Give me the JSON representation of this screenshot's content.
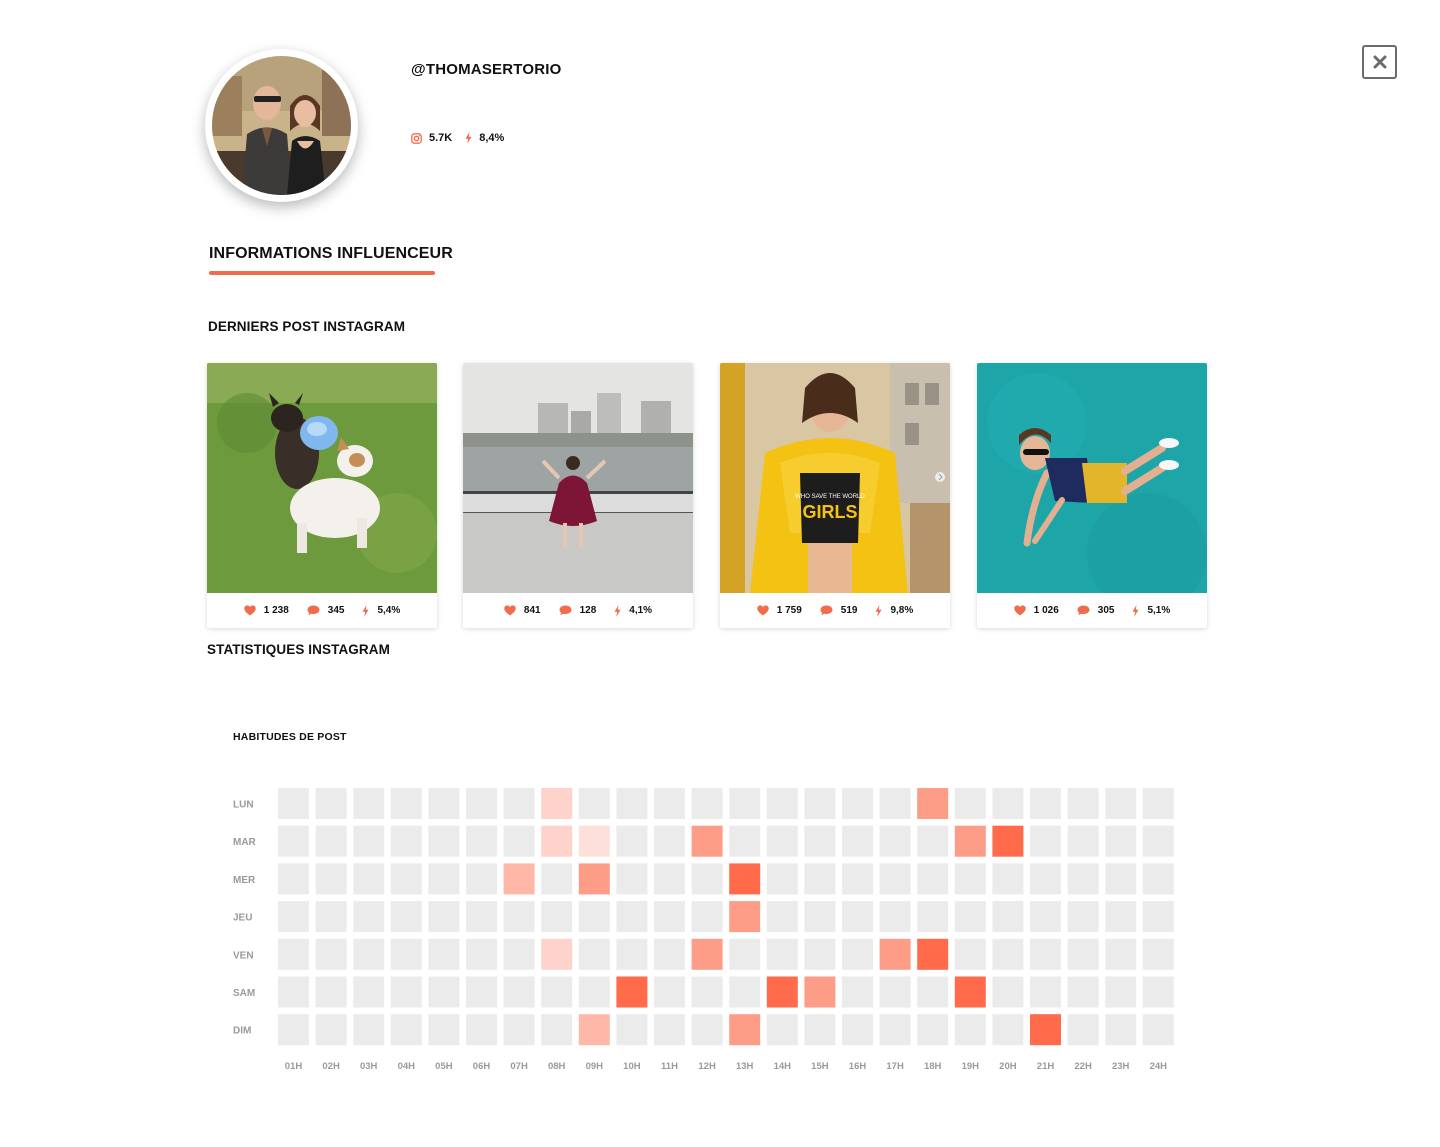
{
  "profile": {
    "handle": "@THOMASERTORIO",
    "followers": "5.7K",
    "engagement": "8,4%"
  },
  "tabs": {
    "active": "INFORMATIONS INFLUENCEUR"
  },
  "sections": {
    "posts_title": "DERNIERS POST INSTAGRAM",
    "stats_title": "STATISTIQUES INSTAGRAM"
  },
  "posts": [
    {
      "likes": "1 238",
      "comments": "345",
      "engagement": "5,4%"
    },
    {
      "likes": "841",
      "comments": "128",
      "engagement": "4,1%"
    },
    {
      "likes": "1 759",
      "comments": "519",
      "engagement": "9,8%"
    },
    {
      "likes": "1 026",
      "comments": "305",
      "engagement": "5,1%"
    }
  ],
  "colors": {
    "accent": "#f16b4d",
    "empty_cell": "#ebebeb"
  },
  "icons": {
    "close": "close-icon",
    "instagram": "instagram-icon",
    "bolt": "bolt-icon",
    "heart": "heart-icon",
    "comment": "comment-icon"
  },
  "chart_data": {
    "type": "heatmap",
    "title": "HABITUDES DE POST",
    "rows": [
      "LUN",
      "MAR",
      "MER",
      "JEU",
      "VEN",
      "SAM",
      "DIM"
    ],
    "columns": [
      "01H",
      "02H",
      "03H",
      "04H",
      "05H",
      "06H",
      "07H",
      "08H",
      "09H",
      "10H",
      "11H",
      "12H",
      "13H",
      "14H",
      "15H",
      "16H",
      "17H",
      "18H",
      "19H",
      "20H",
      "21H",
      "22H",
      "23H",
      "24H"
    ],
    "values": [
      [
        0,
        0,
        0,
        0,
        0,
        0,
        0,
        1,
        0,
        0,
        0,
        0,
        0,
        0,
        0,
        0,
        0,
        3,
        0,
        0,
        0,
        0,
        0,
        0
      ],
      [
        0,
        0,
        0,
        0,
        0,
        0,
        0,
        1,
        0.5,
        0,
        0,
        3,
        0,
        0,
        0,
        0,
        0,
        0,
        3,
        4,
        0,
        0,
        0,
        0
      ],
      [
        0,
        0,
        0,
        0,
        0,
        0,
        2,
        0,
        3,
        0,
        0,
        0,
        4,
        0,
        0,
        0,
        0,
        0,
        0,
        0,
        0,
        0,
        0,
        0
      ],
      [
        0,
        0,
        0,
        0,
        0,
        0,
        0,
        0,
        0,
        0,
        0,
        0,
        3,
        0,
        0,
        0,
        0,
        0,
        0,
        0,
        0,
        0,
        0,
        0
      ],
      [
        0,
        0,
        0,
        0,
        0,
        0,
        0,
        1,
        0,
        0,
        0,
        3,
        0,
        0,
        0,
        0,
        3,
        4,
        0,
        0,
        0,
        0,
        0,
        0
      ],
      [
        0,
        0,
        0,
        0,
        0,
        0,
        0,
        0,
        0,
        3.5,
        0,
        0,
        0,
        4,
        3,
        0,
        0,
        0,
        4,
        0,
        0,
        0,
        0,
        0
      ],
      [
        0,
        0,
        0,
        0,
        0,
        0,
        0,
        0,
        2,
        0,
        0,
        0,
        3,
        0,
        0,
        0,
        0,
        0,
        0,
        0,
        4,
        0,
        0,
        0
      ]
    ],
    "scale_colors": [
      "#ebebeb",
      "#fdd3cb",
      "#ffb8a7",
      "#fd9d87",
      "#ff6b4b"
    ]
  }
}
